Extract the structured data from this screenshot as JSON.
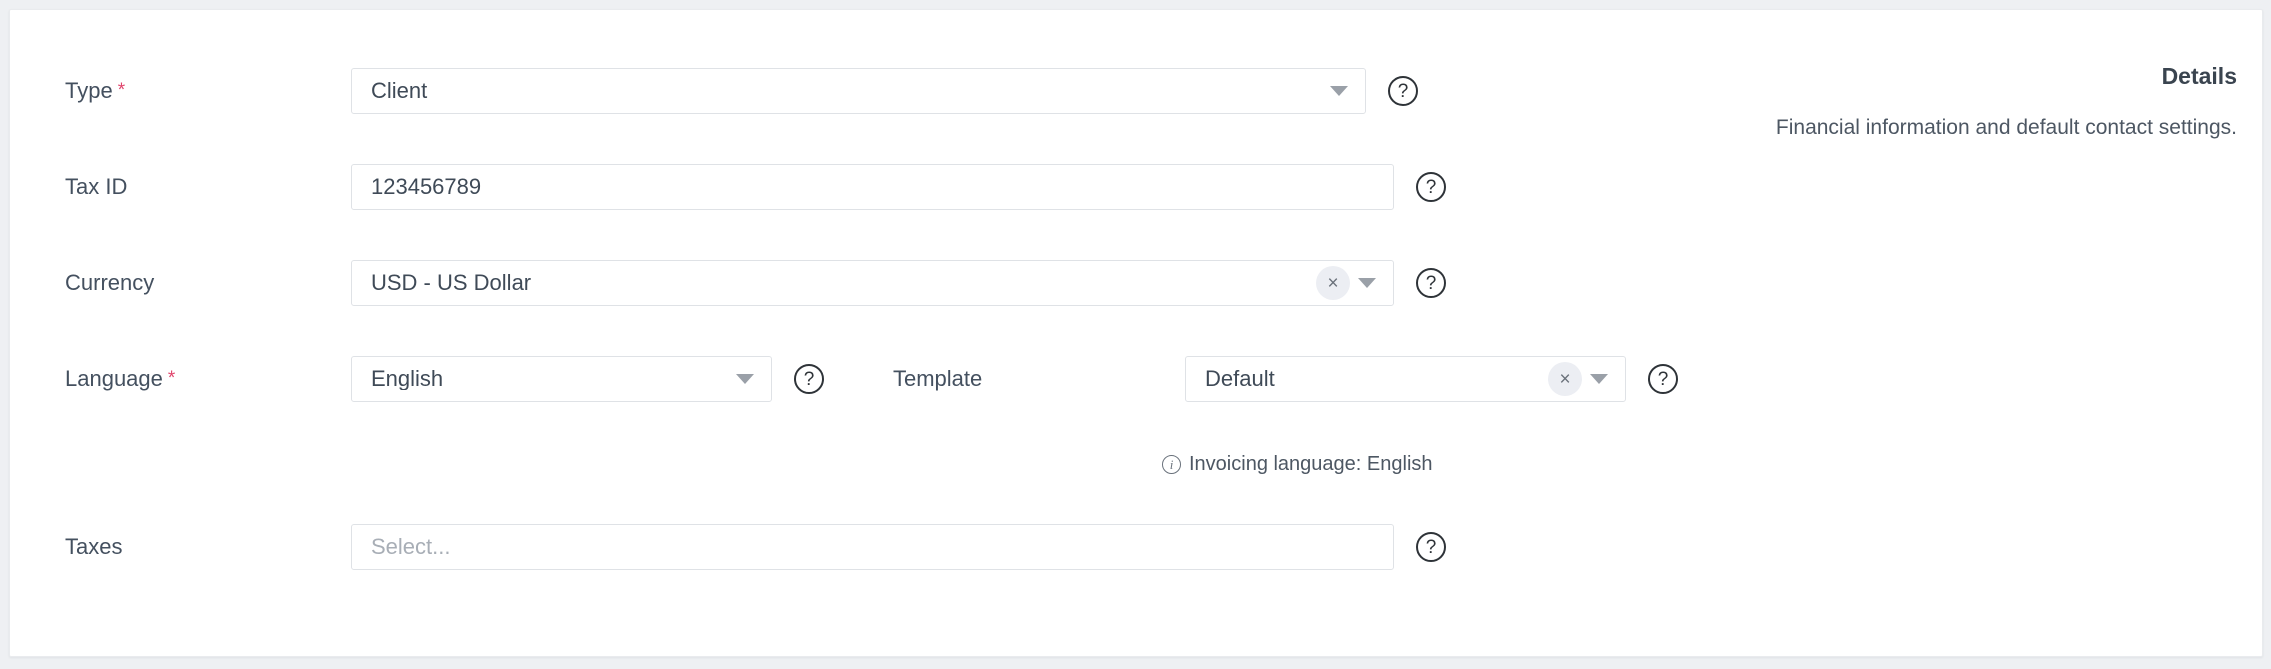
{
  "card": {
    "details": {
      "title": "Details",
      "description": "Financial information and default contact settings."
    },
    "fields": {
      "type": {
        "label": "Type",
        "required_marker": "*",
        "value": "Client",
        "help_glyph": "?",
        "caret_glyph": "▼"
      },
      "tax_id": {
        "label": "Tax ID",
        "value": "123456789",
        "help_glyph": "?"
      },
      "currency": {
        "label": "Currency",
        "value": "USD - US Dollar",
        "clear_glyph": "×",
        "caret_glyph": "▼",
        "help_glyph": "?"
      },
      "language": {
        "label": "Language",
        "required_marker": "*",
        "value": "English",
        "caret_glyph": "▼",
        "help_glyph": "?"
      },
      "template": {
        "label": "Template",
        "value": "Default",
        "clear_glyph": "×",
        "caret_glyph": "▼",
        "help_glyph": "?"
      },
      "taxes": {
        "label": "Taxes",
        "placeholder": "Select...",
        "value": "Select...",
        "help_glyph": "?"
      }
    },
    "hints": {
      "invoicing_language": "Invoicing language: English",
      "info_glyph": "i"
    }
  },
  "colors": {
    "required_asterisk": "#e0456c",
    "label_text": "#44505f",
    "value_text": "#3f4a57",
    "placeholder_text": "#a8aeb6",
    "field_border": "#dfe2e6",
    "card_background": "#ffffff",
    "page_background": "#eef0f3",
    "clear_pill_background": "#eceef3",
    "help_icon_border": "#2e3338"
  }
}
